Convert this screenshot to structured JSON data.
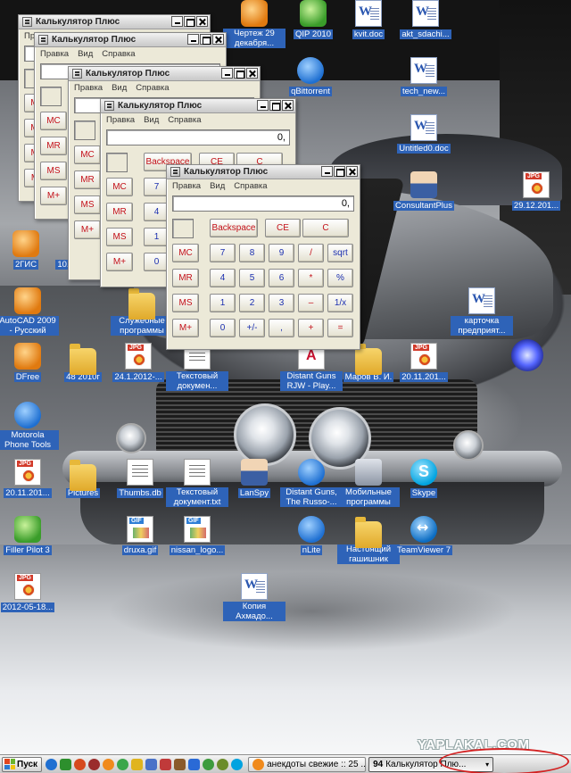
{
  "desktop_icons": [
    {
      "id": "dwg-drawing",
      "label": "Чертеж 29 декабря...",
      "glyph": "g-app-orange"
    },
    {
      "id": "qip",
      "label": "QIP 2010",
      "glyph": "g-app-green"
    },
    {
      "id": "kvit-doc",
      "label": "kvit.doc",
      "glyph": "g-doc"
    },
    {
      "id": "akt-doc",
      "label": "akt_sdachi...",
      "glyph": "g-doc"
    },
    {
      "id": "qbittorrent",
      "label": "qBittorrent",
      "glyph": "g-app-blue"
    },
    {
      "id": "tech-new-doc",
      "label": "tech_new...",
      "glyph": "g-doc"
    },
    {
      "id": "untitled-doc",
      "label": "Untitled0.doc",
      "glyph": "g-doc"
    },
    {
      "id": "consultantplus",
      "label": "ConsultantPlus",
      "glyph": "g-person"
    },
    {
      "id": "jpg-29-12",
      "label": "29.12.201...",
      "glyph": "g-jpg"
    },
    {
      "id": "2gis",
      "label": "2ГИС",
      "glyph": "g-app-orange"
    },
    {
      "id": "jpg-10-4",
      "label": "10.4.2012-...",
      "glyph": "g-jpg"
    },
    {
      "id": "autocad",
      "label": "AutoCAD 2009 - Русский",
      "glyph": "g-app-orange"
    },
    {
      "id": "programs",
      "label": "Служебные программы",
      "glyph": "g-folder"
    },
    {
      "id": "kartochka-doc",
      "label": "карточка предприят...",
      "glyph": "g-doc"
    },
    {
      "id": "dfree",
      "label": "DFree",
      "glyph": "g-app-orange"
    },
    {
      "id": "folder-48",
      "label": "48 2010г",
      "glyph": "g-folder"
    },
    {
      "id": "jpg-24-1",
      "label": "24.1.2012-...",
      "glyph": "g-jpg"
    },
    {
      "id": "txt-doc-1",
      "label": "Текстовый докумен...",
      "glyph": "g-txt"
    },
    {
      "id": "distant-guns-pdf",
      "label": "Distant Guns RJW - Play...",
      "glyph": "g-pdf"
    },
    {
      "id": "marov-folder",
      "label": "Маров В. И.",
      "glyph": "g-folder"
    },
    {
      "id": "jpg-20-11-a",
      "label": "20.11.201...",
      "glyph": "g-jpg"
    },
    {
      "id": "motorola",
      "label": "Motorola Phone Tools",
      "glyph": "g-app-blue"
    },
    {
      "id": "jpg-20-11-b",
      "label": "20.11.201...",
      "glyph": "g-jpg"
    },
    {
      "id": "pictures",
      "label": "Pictures",
      "glyph": "g-folder"
    },
    {
      "id": "thumbs",
      "label": "Thumbs.db",
      "glyph": "g-txt"
    },
    {
      "id": "txt-doc-2",
      "label": "Текстовый документ.txt",
      "glyph": "g-txt"
    },
    {
      "id": "lanspy",
      "label": "LanSpy",
      "glyph": "g-person"
    },
    {
      "id": "distant-guns",
      "label": "Distant Guns, The Russo-...",
      "glyph": "g-app-blue"
    },
    {
      "id": "mobile-programs",
      "label": "Мобильные программы",
      "glyph": "g-phone"
    },
    {
      "id": "skype",
      "label": "Skype",
      "glyph": "g-skype"
    },
    {
      "id": "filler-pilot",
      "label": "Filler Pilot 3",
      "glyph": "g-app-green"
    },
    {
      "id": "druxa-gif",
      "label": "druxa.gif",
      "glyph": "g-gif"
    },
    {
      "id": "nissan-logo",
      "label": "nissan_logo...",
      "glyph": "g-gif"
    },
    {
      "id": "nlite",
      "label": "nLite",
      "glyph": "g-app-blue"
    },
    {
      "id": "real-folder",
      "label": "Настоящий гашишник",
      "glyph": "g-folder"
    },
    {
      "id": "teamviewer",
      "label": "TeamViewer 7",
      "glyph": "g-tv"
    },
    {
      "id": "jpg-2012-05",
      "label": "2012-05-18...",
      "glyph": "g-jpg"
    },
    {
      "id": "kopiya-doc",
      "label": "Копия Ахмадо...",
      "glyph": "g-doc"
    }
  ],
  "calculator": {
    "title": "Калькулятор Плюс",
    "menu": [
      "Правка",
      "Вид",
      "Справка"
    ],
    "display": "0,",
    "top_row": [
      "Backspace",
      "CE",
      "C"
    ],
    "keys": [
      [
        "MC",
        "7",
        "8",
        "9",
        "/",
        "sqrt"
      ],
      [
        "MR",
        "4",
        "5",
        "6",
        "*",
        "%"
      ],
      [
        "MS",
        "1",
        "2",
        "3",
        "–",
        "1/x"
      ],
      [
        "M+",
        "0",
        "+/-",
        ",",
        "+",
        "="
      ]
    ]
  },
  "taskbar": {
    "start_label": "Пуск",
    "items": [
      {
        "label": "анекдоты свежие :: 25 ...",
        "active": false
      },
      {
        "label": "Калькулятор Плю...",
        "count": "94",
        "active": true
      }
    ]
  },
  "watermark": "YAPLAKAL.COM",
  "colors": {
    "icon_label_bg": "#2e63b8",
    "calc_red": "#c4121b",
    "calc_blue": "#1b2fb0",
    "highlight_circle": "#d32020"
  }
}
